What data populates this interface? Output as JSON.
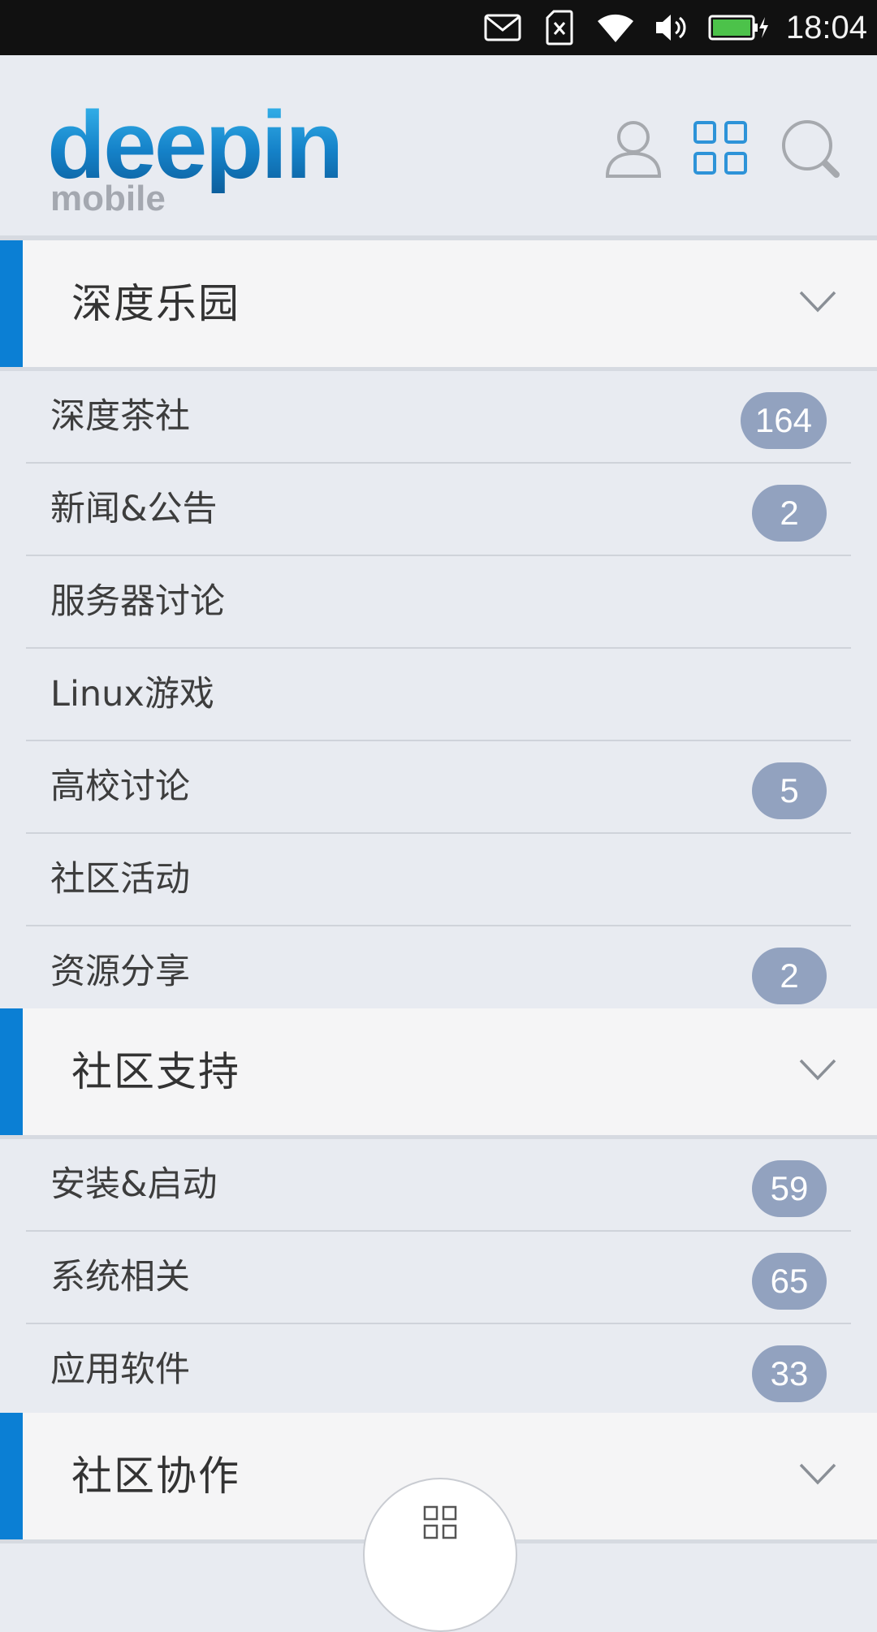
{
  "status_bar": {
    "time": "18:04",
    "icons": [
      "mail-icon",
      "sim-card-icon",
      "wifi-icon",
      "volume-icon",
      "battery-charging-icon"
    ]
  },
  "header": {
    "logo_text": "deepin",
    "logo_sub": "mobile",
    "buttons": [
      "user-icon",
      "grid-menu-icon",
      "search-icon"
    ]
  },
  "colors": {
    "accent": "#0b7fd4",
    "badge_bg": "#92a2bf",
    "background": "#e8ebf1",
    "section_head_bg": "#f5f5f6"
  },
  "sections": [
    {
      "title": "深度乐园",
      "items": [
        {
          "label": "深度茶社",
          "count": "164"
        },
        {
          "label": "新闻&公告",
          "count": "2"
        },
        {
          "label": "服务器讨论",
          "count": ""
        },
        {
          "label": "Linux游戏",
          "count": ""
        },
        {
          "label": "高校讨论",
          "count": "5"
        },
        {
          "label": "社区活动",
          "count": ""
        },
        {
          "label": "资源分享",
          "count": "2"
        }
      ]
    },
    {
      "title": "社区支持",
      "items": [
        {
          "label": "安装&启动",
          "count": "59"
        },
        {
          "label": "系统相关",
          "count": "65"
        },
        {
          "label": "应用软件",
          "count": "33"
        }
      ]
    },
    {
      "title": "社区协作",
      "items": []
    }
  ],
  "fab": {
    "icon": "grid-menu-icon"
  }
}
